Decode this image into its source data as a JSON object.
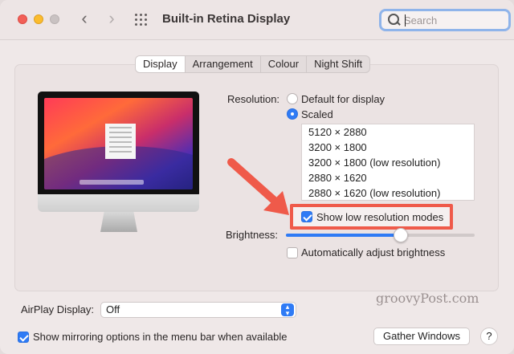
{
  "window": {
    "title": "Built-in Retina Display",
    "traffic_lights": [
      "close",
      "minimize",
      "zoom"
    ],
    "nav": {
      "back_icon": "‹",
      "forward_icon": "›",
      "grid_icon": "show-all-grid"
    }
  },
  "search": {
    "placeholder": "Search",
    "value": ""
  },
  "tabs": [
    {
      "label": "Display",
      "active": true
    },
    {
      "label": "Arrangement",
      "active": false
    },
    {
      "label": "Colour",
      "active": false
    },
    {
      "label": "Night Shift",
      "active": false
    }
  ],
  "display": {
    "image": {
      "logo_glyph": ""
    },
    "resolution": {
      "label": "Resolution:",
      "options": [
        {
          "label": "Default for display",
          "selected": false
        },
        {
          "label": "Scaled",
          "selected": true
        }
      ],
      "list": [
        "5120 × 2880",
        "3200 × 1800",
        "3200 × 1800 (low resolution)",
        "2880 × 1620",
        "2880 × 1620 (low resolution)"
      ]
    },
    "low_res_modes": {
      "label": "Show low resolution modes",
      "checked": true
    },
    "brightness": {
      "label": "Brightness:",
      "level_percent": 61
    },
    "auto_brightness": {
      "label": "Automatically adjust brightness",
      "checked": false
    }
  },
  "airplay": {
    "label": "AirPlay Display:",
    "value": "Off"
  },
  "mirroring": {
    "label": "Show mirroring options in the menu bar when available",
    "checked": true
  },
  "buttons": {
    "gather_windows": "Gather Windows",
    "help": "?"
  },
  "watermark": "groovyPost.com",
  "colors": {
    "accent": "#2f7bf5",
    "highlight": "#ef5a4a",
    "close": "#f25f57",
    "minimize": "#fbbc2e"
  }
}
